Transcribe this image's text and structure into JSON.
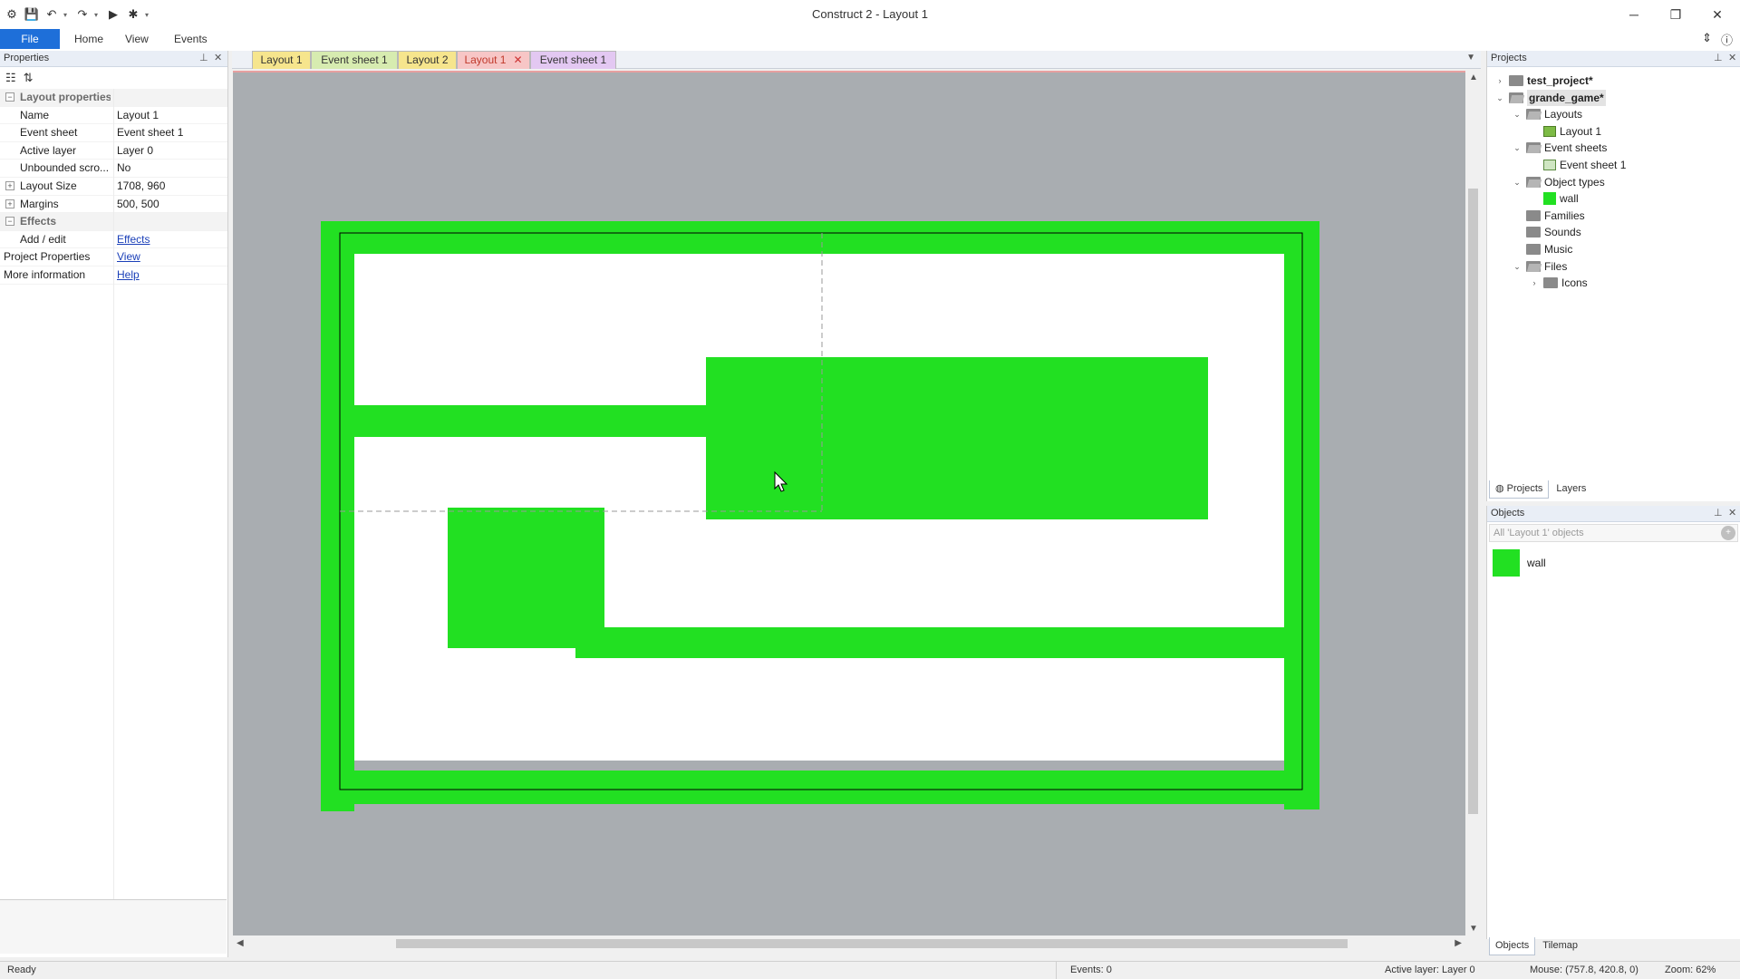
{
  "window": {
    "title": "Construct 2 - Layout 1",
    "controls": [
      "minimize",
      "restore",
      "close"
    ]
  },
  "ribbon": {
    "tabs": [
      "File",
      "Home",
      "View",
      "Events"
    ]
  },
  "properties": {
    "header": "Properties",
    "rows": [
      {
        "name": "Layout properties",
        "value": "",
        "category": true,
        "toggle": "minus"
      },
      {
        "name": "Name",
        "value": "Layout 1"
      },
      {
        "name": "Event sheet",
        "value": "Event sheet 1"
      },
      {
        "name": "Active layer",
        "value": "Layer 0"
      },
      {
        "name": "Unbounded scro...",
        "value": "No"
      },
      {
        "name": "Layout Size",
        "value": "1708, 960",
        "toggle": "plus"
      },
      {
        "name": "Margins",
        "value": "500, 500",
        "toggle": "plus"
      },
      {
        "name": "Effects",
        "value": "",
        "category": true,
        "toggle": "minus"
      },
      {
        "name": "Add / edit",
        "value": "Effects",
        "link": true
      },
      {
        "name": "Project Properties",
        "value": "View",
        "link": true,
        "top": true
      },
      {
        "name": "More information",
        "value": "Help",
        "link": true,
        "top": true
      }
    ]
  },
  "doc_tabs": [
    {
      "label": "Layout 1",
      "color": "#f6e58d"
    },
    {
      "label": "Event sheet 1",
      "color": "#d7ecb0"
    },
    {
      "label": "Layout 2",
      "color": "#f6e58d"
    },
    {
      "label": "Layout 1",
      "color": "#f7c6c6",
      "active": true,
      "closable": true
    },
    {
      "label": "Event sheet 1",
      "color": "#e3c8f2"
    }
  ],
  "layout_view": {
    "object_color": "#22e022",
    "layout_bg": "#ffffff",
    "margin_bg": "#a9adb1"
  },
  "projects": {
    "header": "Projects",
    "tree": [
      {
        "label": "test_project*",
        "depth": 0,
        "icon": "folder",
        "expander": "collapsed",
        "bold": true
      },
      {
        "label": "grande_game*",
        "depth": 0,
        "icon": "folder-open",
        "expander": "expanded",
        "bold": true,
        "selected": true
      },
      {
        "label": "Layouts",
        "depth": 1,
        "icon": "folder-open",
        "expander": "expanded"
      },
      {
        "label": "Layout 1",
        "depth": 2,
        "icon": "layout"
      },
      {
        "label": "Event sheets",
        "depth": 1,
        "icon": "folder-open",
        "expander": "expanded"
      },
      {
        "label": "Event sheet 1",
        "depth": 2,
        "icon": "eventsheet"
      },
      {
        "label": "Object types",
        "depth": 1,
        "icon": "folder-open",
        "expander": "expanded"
      },
      {
        "label": "wall",
        "depth": 2,
        "icon": "green-square"
      },
      {
        "label": "Families",
        "depth": 1,
        "icon": "folder"
      },
      {
        "label": "Sounds",
        "depth": 1,
        "icon": "folder"
      },
      {
        "label": "Music",
        "depth": 1,
        "icon": "folder"
      },
      {
        "label": "Files",
        "depth": 1,
        "icon": "folder-open",
        "expander": "expanded"
      },
      {
        "label": "Icons",
        "depth": 2,
        "icon": "folder",
        "expander": "collapsed"
      }
    ],
    "bottom_tabs": [
      "Projects",
      "Layers"
    ]
  },
  "objects": {
    "header": "Objects",
    "filter_placeholder": "All 'Layout 1' objects",
    "items": [
      {
        "name": "wall",
        "color": "#22e022"
      }
    ],
    "bottom_tabs": [
      "Objects",
      "Tilemap"
    ]
  },
  "statusbar": {
    "status": "Ready",
    "events": "Events: 0",
    "active_layer": "Active layer: Layer 0",
    "mouse": "Mouse: (757.8, 420.8, 0)",
    "zoom": "Zoom: 62%"
  }
}
